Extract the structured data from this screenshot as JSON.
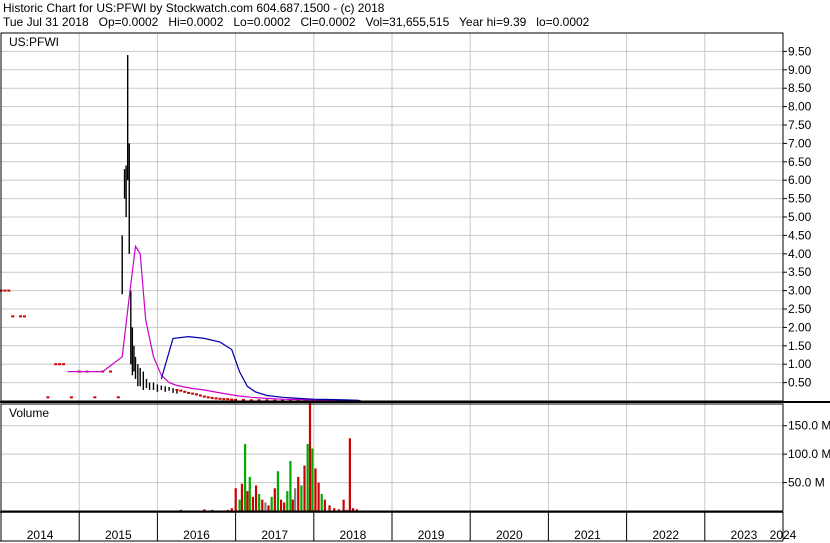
{
  "header": {
    "line1": "Historic Chart for US:PFWI by Stockwatch.com 604.687.1500 - (c) 2018",
    "line2": "Tue Jul 31 2018   Op=0.0002   Hi=0.0002   Lo=0.0002   Cl=0.0002   Vol=31,655,515   Year hi=9.39   lo=0.0002"
  },
  "chart_data": {
    "type": "line",
    "price_panel": {
      "title": "US:PFWI",
      "y_ticks": [
        "9.50",
        "9.00",
        "8.50",
        "8.00",
        "7.50",
        "7.00",
        "6.50",
        "6.00",
        "5.50",
        "5.00",
        "4.50",
        "4.00",
        "3.50",
        "3.00",
        "2.50",
        "2.00",
        "1.50",
        "1.00",
        "0.50"
      ],
      "ylim": [
        0,
        10.0
      ],
      "grid": true,
      "series": [
        {
          "kind": "price_bars",
          "color": "#000000",
          "x": [
            2015.55,
            2015.58,
            2015.6,
            2015.62,
            2015.64,
            2015.66,
            2015.68,
            2015.7,
            2015.72,
            2015.75,
            2015.78,
            2015.82,
            2015.86,
            2015.9,
            2015.95,
            2016.0,
            2016.05,
            2016.1,
            2016.15,
            2016.2,
            2016.25
          ],
          "low": [
            2.9,
            5.5,
            5.0,
            6.0,
            4.0,
            1.0,
            0.7,
            0.8,
            0.6,
            0.4,
            0.4,
            0.3,
            0.35,
            0.3,
            0.3,
            0.25,
            0.3,
            0.25,
            0.28,
            0.22,
            0.2
          ],
          "high": [
            4.5,
            6.3,
            6.4,
            9.4,
            7.0,
            3.0,
            2.0,
            1.5,
            1.2,
            1.0,
            0.9,
            0.8,
            0.6,
            0.5,
            0.5,
            0.45,
            0.42,
            0.4,
            0.38,
            0.35,
            0.3
          ]
        },
        {
          "kind": "close_marks",
          "color": "#cc0000",
          "x": [
            2014.0,
            2014.05,
            2014.1,
            2014.15,
            2014.25,
            2014.3,
            2014.6,
            2014.7,
            2014.75,
            2014.8,
            2014.9,
            2015.0,
            2015.1,
            2015.2,
            2015.3,
            2015.4,
            2015.5,
            2016.25,
            2016.3,
            2016.35,
            2016.4,
            2016.45,
            2016.5,
            2016.55,
            2016.6,
            2016.65,
            2016.7,
            2016.75,
            2016.8,
            2016.85,
            2016.9,
            2016.95,
            2017.0,
            2017.1,
            2017.2,
            2017.3,
            2017.4,
            2017.5,
            2017.6,
            2017.7,
            2017.8,
            2017.9,
            2018.0,
            2018.1,
            2018.2,
            2018.3,
            2018.4,
            2018.5,
            2018.58
          ],
          "y": [
            3.0,
            3.0,
            3.0,
            2.3,
            2.3,
            2.3,
            0.1,
            1.0,
            1.0,
            1.0,
            0.1,
            0.8,
            0.8,
            0.1,
            0.8,
            0.8,
            0.1,
            0.3,
            0.28,
            0.25,
            0.22,
            0.2,
            0.18,
            0.15,
            0.12,
            0.1,
            0.08,
            0.07,
            0.06,
            0.05,
            0.05,
            0.04,
            0.03,
            0.03,
            0.02,
            0.02,
            0.02,
            0.01,
            0.01,
            0.01,
            0.01,
            0.01,
            0.01,
            0.005,
            0.005,
            0.003,
            0.002,
            0.002,
            0.0002
          ]
        },
        {
          "kind": "line",
          "name": "",
          "color": "#cc00cc",
          "x": [
            2014.85,
            2015.0,
            2015.3,
            2015.55,
            2015.65,
            2015.72,
            2015.78,
            2015.85,
            2015.95,
            2016.05,
            2016.15,
            2016.25,
            2016.35,
            2016.45,
            2016.6,
            2016.8,
            2017.0,
            2017.2,
            2017.4,
            2017.6,
            2017.8,
            2018.0,
            2018.2,
            2018.4,
            2018.58
          ],
          "y": [
            0.8,
            0.8,
            0.8,
            1.2,
            3.0,
            4.2,
            4.0,
            2.2,
            1.2,
            0.7,
            0.5,
            0.42,
            0.38,
            0.34,
            0.3,
            0.22,
            0.15,
            0.1,
            0.07,
            0.05,
            0.04,
            0.03,
            0.02,
            0.01,
            0.01
          ]
        },
        {
          "kind": "line",
          "name": "",
          "color": "#0000aa",
          "x": [
            2016.05,
            2016.2,
            2016.4,
            2016.6,
            2016.8,
            2016.95,
            2017.05,
            2017.15,
            2017.25,
            2017.4,
            2017.6,
            2017.8,
            2018.0,
            2018.2,
            2018.4,
            2018.58
          ],
          "y": [
            0.6,
            1.7,
            1.75,
            1.7,
            1.6,
            1.4,
            0.8,
            0.4,
            0.25,
            0.15,
            0.1,
            0.07,
            0.05,
            0.04,
            0.03,
            0.02
          ]
        }
      ]
    },
    "volume_panel": {
      "title": "Volume",
      "y_ticks": [
        "150.0 M",
        "100.0 M",
        "50.0 M"
      ],
      "ylim": [
        0,
        190
      ],
      "grid": true,
      "bars": {
        "x": [
          2016.3,
          2016.6,
          2016.7,
          2016.9,
          2016.95,
          2017.0,
          2017.05,
          2017.08,
          2017.12,
          2017.15,
          2017.18,
          2017.22,
          2017.26,
          2017.3,
          2017.34,
          2017.38,
          2017.42,
          2017.46,
          2017.5,
          2017.54,
          2017.58,
          2017.62,
          2017.66,
          2017.7,
          2017.73,
          2017.76,
          2017.8,
          2017.84,
          2017.88,
          2017.92,
          2017.95,
          2017.98,
          2018.02,
          2018.06,
          2018.1,
          2018.14,
          2018.2,
          2018.26,
          2018.32,
          2018.38,
          2018.42,
          2018.46,
          2018.5,
          2018.55
        ],
        "values": [
          2,
          3,
          2,
          2,
          5,
          40,
          20,
          48,
          118,
          35,
          60,
          25,
          45,
          30,
          20,
          15,
          10,
          25,
          40,
          70,
          20,
          15,
          35,
          88,
          20,
          40,
          60,
          45,
          80,
          118,
          190,
          110,
          75,
          50,
          30,
          20,
          10,
          5,
          3,
          20,
          2,
          128,
          5,
          3
        ],
        "colors": [
          "#cc0000",
          "#cc0000",
          "#cc0000",
          "#cc0000",
          "#cc0000",
          "#cc0000",
          "#00aa00",
          "#cc0000",
          "#00aa00",
          "#cc0000",
          "#00aa00",
          "#cc0000",
          "#cc0000",
          "#00aa00",
          "#cc0000",
          "#808080",
          "#cc0000",
          "#00aa00",
          "#cc0000",
          "#00aa00",
          "#cc0000",
          "#cc0000",
          "#00aa00",
          "#00aa00",
          "#cc0000",
          "#808080",
          "#cc0000",
          "#00aa00",
          "#cc0000",
          "#00aa00",
          "#cc0000",
          "#00aa00",
          "#cc0000",
          "#cc0000",
          "#00aa00",
          "#cc0000",
          "#cc0000",
          "#cc0000",
          "#cc0000",
          "#cc0000",
          "#cc0000",
          "#cc0000",
          "#cc0000",
          "#cc0000"
        ]
      }
    },
    "x_axis": {
      "labels": [
        "2014",
        "2015",
        "2016",
        "2017",
        "2018",
        "2019",
        "2020",
        "2021",
        "2022",
        "2023",
        "2024"
      ],
      "xlim": [
        2014.0,
        2024.0
      ]
    },
    "colors": {
      "grid": "#c8c8c8",
      "axis": "#000000",
      "background": "#ffffff"
    }
  }
}
